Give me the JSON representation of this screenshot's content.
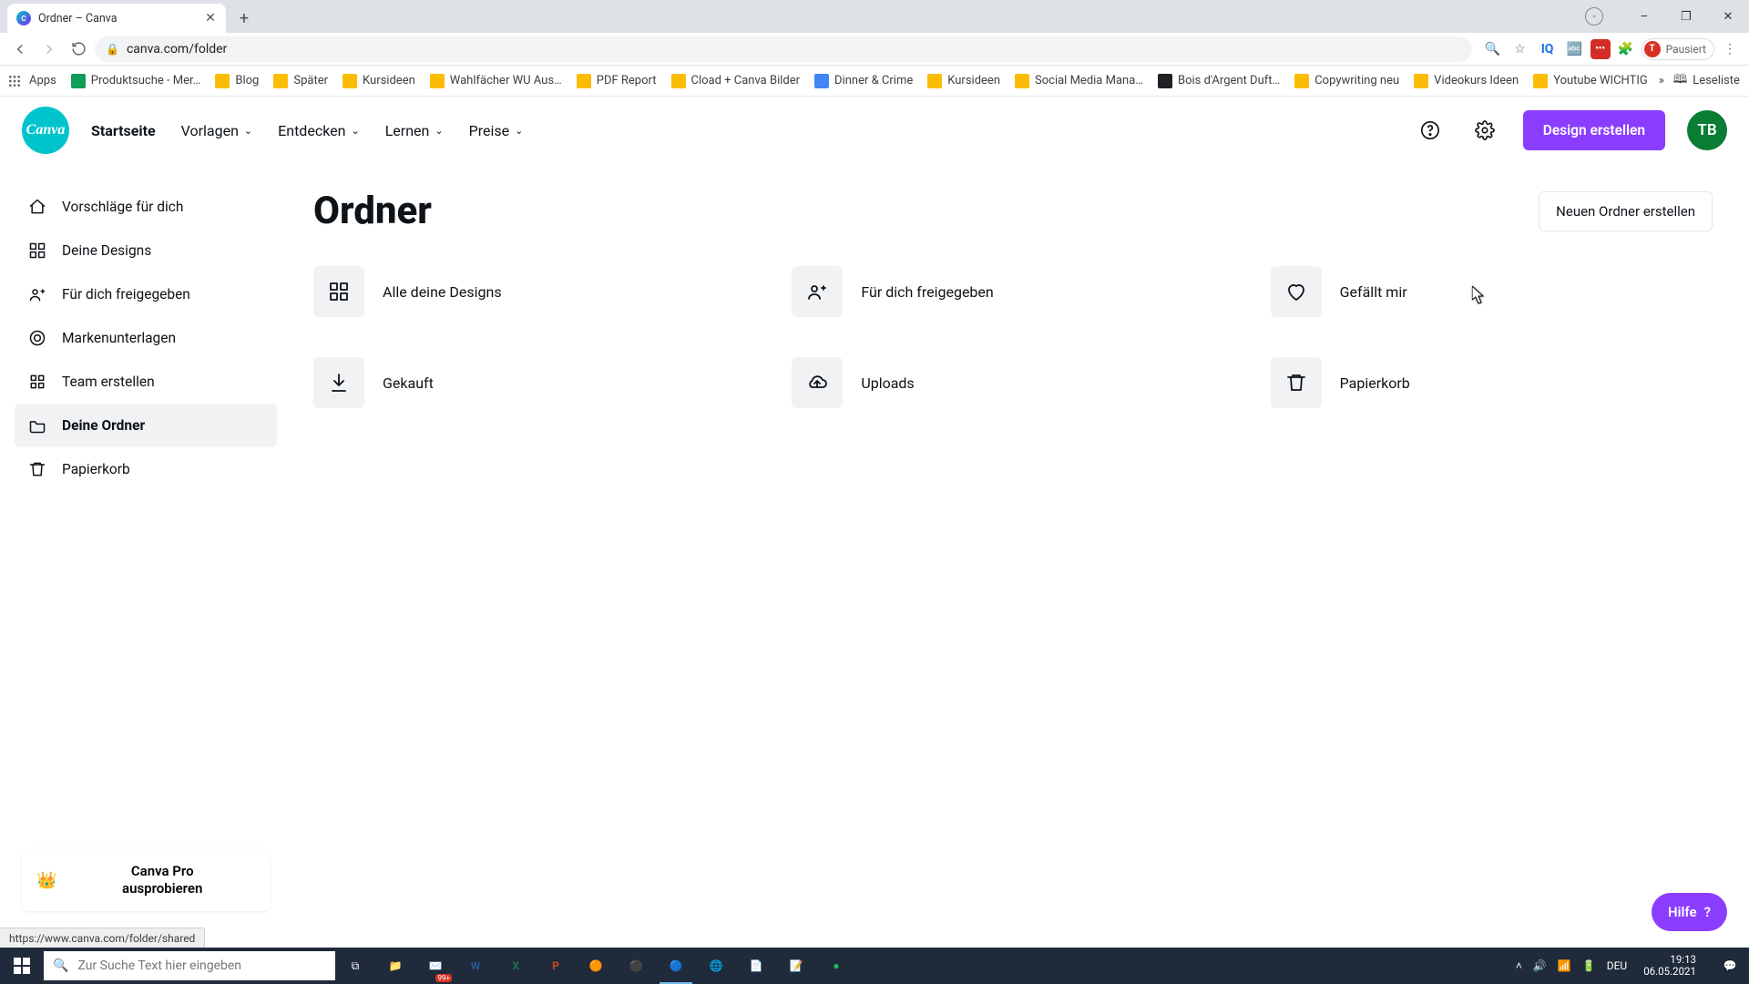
{
  "browser": {
    "tab_title": "Ordner – Canva",
    "new_tab_tooltip": "Neuer Tab",
    "url": "canva.com/folder",
    "profile_state": "Pausiert",
    "profile_initial": "T",
    "window_controls": {
      "minimize": "–",
      "maximize": "❐",
      "close": "✕"
    }
  },
  "bookmarks": {
    "apps_label": "Apps",
    "items": [
      "Produktsuche - Mer…",
      "Blog",
      "Später",
      "Kursideen",
      "Wahlfächer WU Aus…",
      "PDF Report",
      "Cload + Canva Bilder",
      "Dinner & Crime",
      "Kursideen",
      "Social Media Mana…",
      "Bois d'Argent Duft…",
      "Copywriting neu",
      "Videokurs Ideen",
      "Youtube WICHTIG"
    ],
    "overflow": "»",
    "reading_list": "Leseliste"
  },
  "canva": {
    "logo_text": "Canva",
    "nav": {
      "home": "Startseite",
      "templates": "Vorlagen",
      "discover": "Entdecken",
      "learn": "Lernen",
      "pricing": "Preise"
    },
    "create_design": "Design erstellen",
    "avatar_initials": "TB",
    "sidebar": {
      "items": [
        {
          "label": "Vorschläge für dich",
          "icon": "home"
        },
        {
          "label": "Deine Designs",
          "icon": "grid"
        },
        {
          "label": "Für dich freigegeben",
          "icon": "share"
        },
        {
          "label": "Markenunterlagen",
          "icon": "brand"
        },
        {
          "label": "Team erstellen",
          "icon": "team"
        },
        {
          "label": "Deine Ordner",
          "icon": "folder"
        },
        {
          "label": "Papierkorb",
          "icon": "trash"
        }
      ],
      "active_index": 5,
      "pro": {
        "line1": "Canva Pro",
        "line2": "ausprobieren"
      }
    },
    "main": {
      "heading": "Ordner",
      "new_folder": "Neuen Ordner erstellen",
      "folders": [
        {
          "label": "Alle deine Designs",
          "icon": "grid"
        },
        {
          "label": "Für dich freigegeben",
          "icon": "share"
        },
        {
          "label": "Gefällt mir",
          "icon": "heart"
        },
        {
          "label": "Gekauft",
          "icon": "download"
        },
        {
          "label": "Uploads",
          "icon": "cloud"
        },
        {
          "label": "Papierkorb",
          "icon": "trash"
        }
      ]
    },
    "help_label": "Hilfe",
    "status_url": "https://www.canva.com/folder/shared"
  },
  "taskbar": {
    "search_placeholder": "Zur Suche Text hier eingeben",
    "lang": "DEU",
    "time": "19:13",
    "date": "06.05.2021",
    "app_badge": "99+"
  }
}
